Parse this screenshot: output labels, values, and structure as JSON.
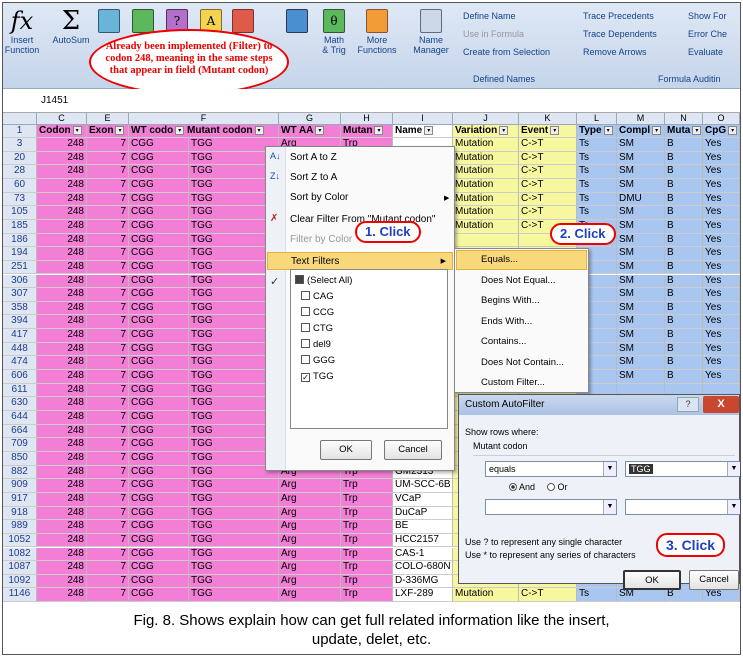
{
  "ribbon": {
    "insert_function": "Insert\nFunction",
    "autosum": "AutoSum",
    "math_trig": "Math\n& Trig",
    "more_functions": "More\nFunctions",
    "name_manager": "Name\nManager",
    "define_name": "Define Name",
    "use_in_formula": "Use in Formula",
    "create_from_selection": "Create from Selection",
    "defined_names": "Defined Names",
    "trace_precedents": "Trace Precedents",
    "trace_dependents": "Trace Dependents",
    "remove_arrows": "Remove Arrows",
    "show_form": "Show For",
    "error_check": "Error Che",
    "evaluate": "Evaluate",
    "formula_auditing": "Formula Auditin"
  },
  "callout_text": "Already been implemented (Filter) to codon 248, meaning in the same steps that appear in field (Mutant codon)",
  "namebox": "J1451",
  "columns": [
    "C",
    "E",
    "F",
    "G",
    "H",
    "I",
    "J",
    "K",
    "L",
    "M",
    "N",
    "O"
  ],
  "headers": {
    "codon": "Codon",
    "exon": "Exon",
    "wt_codon": "WT codo",
    "mutant_codon": "Mutant codon",
    "wt_aa": "WT AA",
    "mutant_aa": "Mutan",
    "name": "Name",
    "variation": "Variation",
    "event": "Event",
    "type": "Type",
    "compl": "Compl",
    "muta": "Muta",
    "cpg": "CpG"
  },
  "rows": [
    {
      "n": "3",
      "name": "",
      "var": "Mutation",
      "ev": "C->T",
      "ty": "Ts",
      "co": "SM",
      "mu": "B",
      "cp": "Yes"
    },
    {
      "n": "20",
      "name": "",
      "var": "Mutation",
      "ev": "C->T",
      "ty": "Ts",
      "co": "SM",
      "mu": "B",
      "cp": "Yes"
    },
    {
      "n": "28",
      "name": "",
      "var": "Mutation",
      "ev": "C->T",
      "ty": "Ts",
      "co": "SM",
      "mu": "B",
      "cp": "Yes"
    },
    {
      "n": "60",
      "name": "",
      "var": "Mutation",
      "ev": "C->T",
      "ty": "Ts",
      "co": "SM",
      "mu": "B",
      "cp": "Yes"
    },
    {
      "n": "73",
      "name": "",
      "var": "Mutation",
      "ev": "C->T",
      "ty": "Ts",
      "co": "DMU",
      "mu": "B",
      "cp": "Yes"
    },
    {
      "n": "105",
      "name": "",
      "var": "Mutation",
      "ev": "C->T",
      "ty": "Ts",
      "co": "SM",
      "mu": "B",
      "cp": "Yes"
    },
    {
      "n": "185",
      "name": "",
      "var": "Mutation",
      "ev": "C->T",
      "ty": "Ts",
      "co": "SM",
      "mu": "B",
      "cp": "Yes"
    },
    {
      "n": "186",
      "name": "",
      "var": "",
      "ev": "",
      "ty": "",
      "co": "SM",
      "mu": "B",
      "cp": "Yes"
    },
    {
      "n": "194",
      "name": "",
      "var": "",
      "ev": "",
      "ty": "Ts",
      "co": "SM",
      "mu": "B",
      "cp": "Yes"
    },
    {
      "n": "251",
      "name": "",
      "var": "",
      "ev": "",
      "ty": "Ts",
      "co": "SM",
      "mu": "B",
      "cp": "Yes"
    },
    {
      "n": "306",
      "name": "",
      "var": "",
      "ev": "",
      "ty": "Ts",
      "co": "SM",
      "mu": "B",
      "cp": "Yes"
    },
    {
      "n": "307",
      "name": "",
      "var": "",
      "ev": "",
      "ty": "Ts",
      "co": "SM",
      "mu": "B",
      "cp": "Yes"
    },
    {
      "n": "358",
      "name": "",
      "var": "",
      "ev": "",
      "ty": "Ts",
      "co": "SM",
      "mu": "B",
      "cp": "Yes"
    },
    {
      "n": "394",
      "name": "",
      "var": "",
      "ev": "",
      "ty": "Ts",
      "co": "SM",
      "mu": "B",
      "cp": "Yes"
    },
    {
      "n": "417",
      "name": "",
      "var": "",
      "ev": "",
      "ty": "Ts",
      "co": "SM",
      "mu": "B",
      "cp": "Yes"
    },
    {
      "n": "448",
      "name": "",
      "var": "",
      "ev": "",
      "ty": "Ts",
      "co": "SM",
      "mu": "B",
      "cp": "Yes"
    },
    {
      "n": "474",
      "name": "",
      "var": "",
      "ev": "",
      "ty": "Ts",
      "co": "SM",
      "mu": "B",
      "cp": "Yes"
    },
    {
      "n": "606",
      "name": "",
      "var": "",
      "ev": "",
      "ty": "Ts",
      "co": "SM",
      "mu": "B",
      "cp": "Yes"
    },
    {
      "n": "611",
      "name": "",
      "var": "",
      "ev": "",
      "ty": "",
      "co": "",
      "mu": "",
      "cp": ""
    },
    {
      "n": "630",
      "name": "",
      "var": "",
      "ev": "",
      "ty": "",
      "co": "",
      "mu": "",
      "cp": ""
    },
    {
      "n": "644",
      "name": "",
      "var": "",
      "ev": "",
      "ty": "",
      "co": "",
      "mu": "",
      "cp": ""
    },
    {
      "n": "664",
      "name": "",
      "var": "",
      "ev": "",
      "ty": "",
      "co": "",
      "mu": "",
      "cp": ""
    },
    {
      "n": "709",
      "name": "",
      "var": "",
      "ev": "",
      "ty": "",
      "co": "",
      "mu": "",
      "cp": ""
    },
    {
      "n": "850",
      "name": "",
      "var": "",
      "ev": "",
      "ty": "",
      "co": "",
      "mu": "",
      "cp": ""
    },
    {
      "n": "882",
      "name": "GM2313",
      "var": "",
      "ev": "",
      "ty": "",
      "co": "",
      "mu": "",
      "cp": ""
    },
    {
      "n": "909",
      "name": "UM-SCC-6B",
      "var": "",
      "ev": "",
      "ty": "",
      "co": "",
      "mu": "",
      "cp": ""
    },
    {
      "n": "917",
      "name": "VCaP",
      "var": "",
      "ev": "",
      "ty": "",
      "co": "",
      "mu": "",
      "cp": ""
    },
    {
      "n": "918",
      "name": "DuCaP",
      "var": "",
      "ev": "",
      "ty": "",
      "co": "",
      "mu": "",
      "cp": ""
    },
    {
      "n": "989",
      "name": "BE",
      "var": "",
      "ev": "",
      "ty": "",
      "co": "",
      "mu": "",
      "cp": ""
    },
    {
      "n": "1052",
      "name": "HCC2157",
      "var": "",
      "ev": "",
      "ty": "",
      "co": "",
      "mu": "",
      "cp": ""
    },
    {
      "n": "1082",
      "name": "CAS-1",
      "var": "",
      "ev": "",
      "ty": "",
      "co": "",
      "mu": "",
      "cp": ""
    },
    {
      "n": "1087",
      "name": "COLO-680N",
      "var": "",
      "ev": "",
      "ty": "",
      "co": "",
      "mu": "",
      "cp": ""
    },
    {
      "n": "1092",
      "name": "D-336MG",
      "var": "",
      "ev": "",
      "ty": "",
      "co": "",
      "mu": "",
      "cp": ""
    },
    {
      "n": "1146",
      "name": "LXF-289",
      "var": "Mutation",
      "ev": "C->T",
      "ty": "Ts",
      "co": "SM",
      "mu": "B",
      "cp": "Yes"
    }
  ],
  "common": {
    "codon": "248",
    "exon": "7",
    "wt": "CGG",
    "mut": "TGG",
    "wtaa": "Arg",
    "mutaa": "Trp"
  },
  "filter_menu": {
    "sort_az": "Sort A to Z",
    "sort_za": "Sort Z to A",
    "sort_color": "Sort by Color",
    "clear_filter": "Clear Filter From \"Mutant codon\"",
    "filter_color": "Filter by Color",
    "text_filters": "Text Filters",
    "select_all": "(Select All)",
    "values": [
      "CAG",
      "CCG",
      "CTG",
      "del9",
      "GGG",
      "TGG"
    ],
    "checked": [
      false,
      false,
      false,
      false,
      false,
      true
    ],
    "ok": "OK",
    "cancel": "Cancel"
  },
  "submenu": [
    "Equals...",
    "Does Not Equal...",
    "Begins With...",
    "Ends With...",
    "Contains...",
    "Does Not Contain...",
    "Custom Filter..."
  ],
  "clicks": {
    "one": "1. Click",
    "two": "2. Click",
    "three": "3. Click"
  },
  "dialog": {
    "title": "Custom AutoFilter",
    "show_rows": "Show rows where:",
    "field": "Mutant codon",
    "operator": "equals",
    "value": "TGG",
    "and": "And",
    "or": "Or",
    "hint1": "Use ? to represent any single character",
    "hint2": "Use * to represent any series of characters",
    "ok": "OK",
    "cancel": "Cancel",
    "help": "?",
    "close": "X"
  },
  "caption_line1": "Fig. 8. Shows explain how can get full related information like the insert,",
  "caption_line2": "update, delet, etc."
}
